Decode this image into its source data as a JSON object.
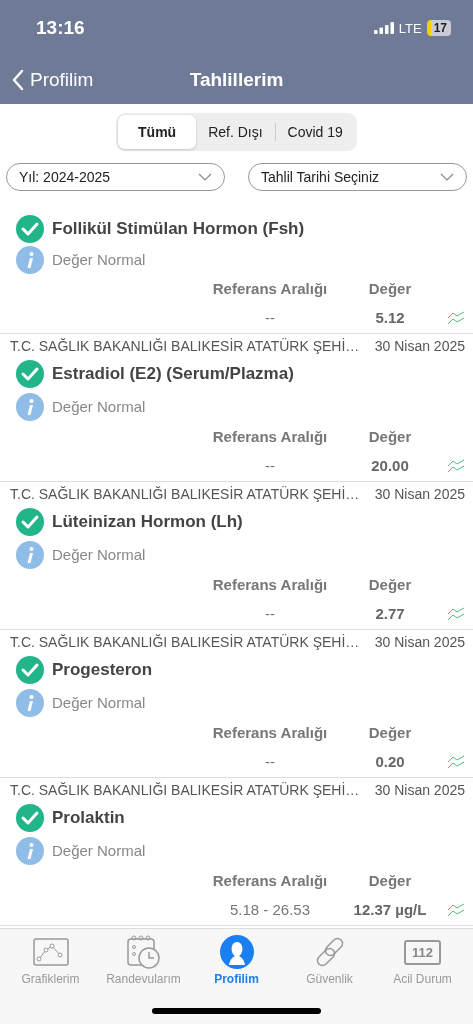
{
  "status_bar": {
    "time": "13:16",
    "network": "LTE",
    "battery": "17"
  },
  "nav": {
    "back": "Profilim",
    "title": "Tahlillerim"
  },
  "segments": [
    {
      "label": "Tümü",
      "selected": true
    },
    {
      "label": "Ref. Dışı",
      "selected": false
    },
    {
      "label": "Covid 19",
      "selected": false
    }
  ],
  "filters": [
    {
      "value": "Yıl: 2024-2025"
    },
    {
      "value": "Tahlil Tarihi Seçiniz"
    }
  ],
  "results": [
    {
      "name": "Follikül Stimülan Hormon (Fsh)",
      "normal": true,
      "status": "Değer Normal",
      "ref_label": "Referans Aralığı",
      "value_label": "Değer",
      "ref": "--",
      "value": "5.12"
    },
    {
      "hospital": "T.C. SAĞLIK BAKANLIĞI BALIKESİR ATATÜRK ŞEHİ…",
      "date": "30 Nisan 2025",
      "name": "Estradiol (E2) (Serum/Plazma)",
      "normal": true,
      "status": "Değer Normal",
      "ref_label": "Referans Aralığı",
      "value_label": "Değer",
      "ref": "--",
      "value": "20.00"
    },
    {
      "hospital": "T.C. SAĞLIK BAKANLIĞI BALIKESİR ATATÜRK ŞEHİ…",
      "date": "30 Nisan 2025",
      "name": "Lüteinizan Hormon (Lh)",
      "normal": true,
      "status": "Değer Normal",
      "ref_label": "Referans Aralığı",
      "value_label": "Değer",
      "ref": "--",
      "value": "2.77"
    },
    {
      "hospital": "T.C. SAĞLIK BAKANLIĞI BALIKESİR ATATÜRK ŞEHİ…",
      "date": "30 Nisan 2025",
      "name": "Progesteron",
      "normal": true,
      "status": "Değer Normal",
      "ref_label": "Referans Aralığı",
      "value_label": "Değer",
      "ref": "--",
      "value": "0.20"
    },
    {
      "hospital": "T.C. SAĞLIK BAKANLIĞI BALIKESİR ATATÜRK ŞEHİ…",
      "date": "30 Nisan 2025",
      "name": "Prolaktin",
      "normal": true,
      "status": "Değer Normal",
      "ref_label": "Referans Aralığı",
      "value_label": "Değer",
      "ref": "5.18 - 26.53",
      "value": "12.37 µg/L"
    }
  ],
  "tab_bar": [
    {
      "kind": "chart",
      "label": "Grafiklerim",
      "selected": false
    },
    {
      "kind": "calendar",
      "label": "Randevularım",
      "selected": false
    },
    {
      "kind": "profile",
      "label": "Profilim",
      "selected": true
    },
    {
      "kind": "link",
      "label": "Güvenlik",
      "selected": false
    },
    {
      "kind": "emergency",
      "label": "Acil Durum",
      "badge": "112",
      "selected": false
    }
  ]
}
